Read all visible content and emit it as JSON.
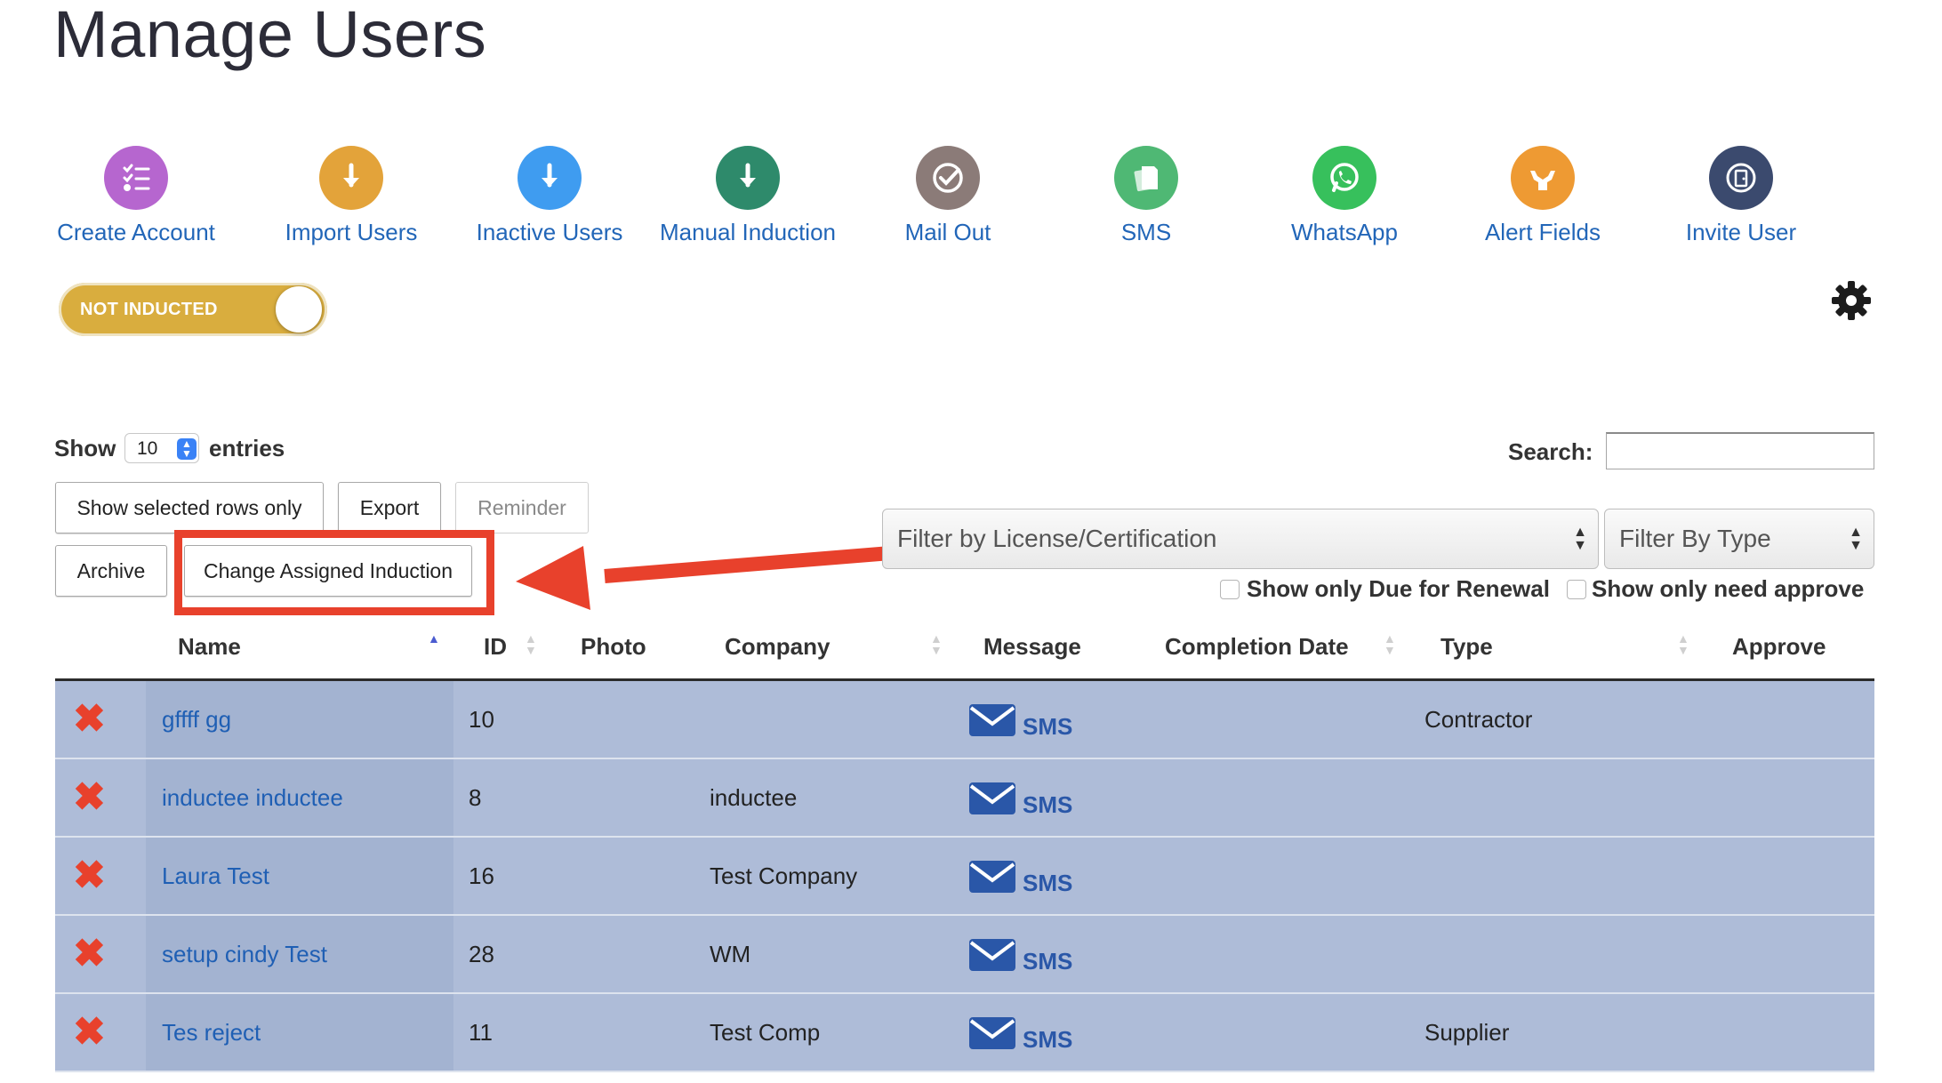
{
  "page": {
    "title": "Manage Users"
  },
  "actions": [
    {
      "label": "Create Account",
      "icon": "list-check-icon",
      "color": "#b666cf"
    },
    {
      "label": "Import Users",
      "icon": "download-arrow-icon",
      "color": "#e3a33a"
    },
    {
      "label": "Inactive Users",
      "icon": "download-arrow-icon",
      "color": "#3f9cf0"
    },
    {
      "label": "Manual Induction",
      "icon": "download-arrow-icon",
      "color": "#2e8a6b"
    },
    {
      "label": "Mail Out",
      "icon": "checkmark-circle-icon",
      "color": "#8b7b78"
    },
    {
      "label": "SMS",
      "icon": "documents-icon",
      "color": "#4fb874"
    },
    {
      "label": "WhatsApp",
      "icon": "whatsapp-icon",
      "color": "#37c05c"
    },
    {
      "label": "Alert Fields",
      "icon": "hands-icon",
      "color": "#ee9a33"
    },
    {
      "label": "Invite User",
      "icon": "door-icon",
      "color": "#3b4a6e"
    }
  ],
  "toggle": {
    "label": "NOT INDUCTED",
    "color": "#d9ad3e"
  },
  "settings": {
    "icon": "gear-icon"
  },
  "length": {
    "show": "Show",
    "value": "10",
    "entries": "entries"
  },
  "search": {
    "label": "Search:",
    "value": ""
  },
  "buttons": {
    "show_selected": "Show selected rows only",
    "export": "Export",
    "reminder": "Reminder",
    "archive": "Archive",
    "change_induction": "Change Assigned Induction"
  },
  "filters": {
    "license_placeholder": "Filter by License/Certification",
    "type_placeholder": "Filter By Type",
    "due_renewal": "Show only Due for Renewal",
    "need_approve": "Show only need approve"
  },
  "table": {
    "headers": {
      "name": "Name",
      "id": "ID",
      "photo": "Photo",
      "company": "Company",
      "message": "Message",
      "completion_date": "Completion Date",
      "type": "Type",
      "approve": "Approve"
    },
    "rows": [
      {
        "name": "gffff gg",
        "id": "10",
        "company": "",
        "sms": "SMS",
        "type": "Contractor"
      },
      {
        "name": "inductee inductee",
        "id": "8",
        "company": "inductee",
        "sms": "SMS",
        "type": ""
      },
      {
        "name": "Laura Test",
        "id": "16",
        "company": "Test Company",
        "sms": "SMS",
        "type": ""
      },
      {
        "name": "setup cindy Test",
        "id": "28",
        "company": "WM",
        "sms": "SMS",
        "type": ""
      },
      {
        "name": "Tes reject",
        "id": "11",
        "company": "Test Comp",
        "sms": "SMS",
        "type": "Supplier"
      }
    ]
  },
  "annotation": {
    "color": "#e8412c"
  }
}
